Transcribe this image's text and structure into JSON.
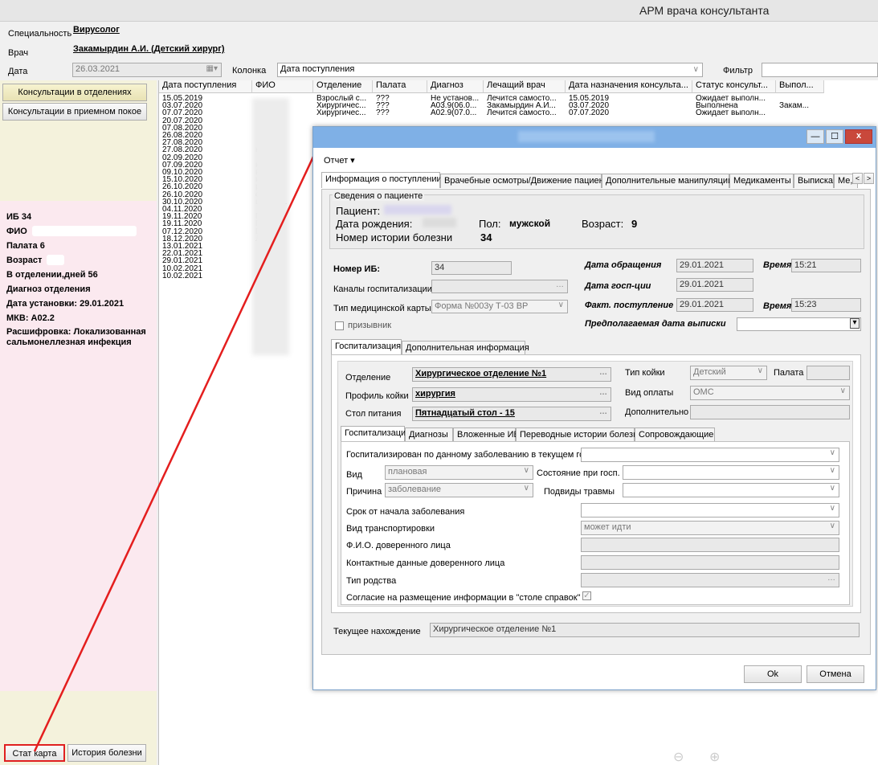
{
  "app": {
    "title": "АРМ врача консультанта"
  },
  "header": {
    "specialty_label": "Специальность",
    "specialty_value": "Вирусолог",
    "doctor_label": "Врач",
    "doctor_value": "Закамырдин А.И. (Детский хирург)",
    "date_label": "Дата",
    "date_value": "26.03.2021",
    "column_label": "Колонка",
    "column_value": "Дата поступления",
    "filter_label": "Фильтр",
    "filter_value": ""
  },
  "left": {
    "btn_department": "Консультации в отделениях",
    "btn_reception": "Консультации в приемном покое",
    "info": {
      "ib": "ИБ 34",
      "fio": "ФИО",
      "ward": "Палата 6",
      "age": "Возраст",
      "days": "В отделении,дней 56",
      "diag_dept": "Диагноз отделения",
      "date_set": "Дата установки: 29.01.2021",
      "mkb": "МКВ: A02.2",
      "decode": "Расшифровка: Локализованная сальмонеллезная инфекция"
    },
    "btn_stat": "Стат карта",
    "btn_history": "История болезни"
  },
  "grid": {
    "columns": [
      "Дата поступления",
      "ФИО",
      "Отделение",
      "Палата",
      "Диагноз",
      "Лечащий врач",
      "Дата назначения консульта...",
      "Статус консульт...",
      "Выпол..."
    ],
    "rows": [
      [
        "15.05.2019",
        "",
        "Взрослый с...",
        "???",
        "Не установ...",
        "Лечится самосто...",
        "15.05.2019",
        "Ожидает выполн...",
        ""
      ],
      [
        "03.07.2020",
        "",
        "Хирургичес...",
        "???",
        "A03.9(06.0...",
        "Закамырдин А.И...",
        "03.07.2020",
        "Выполнена",
        "Закам..."
      ],
      [
        "07.07.2020",
        "",
        "Хирургичес...",
        "???",
        "A02.9(07.0...",
        "Лечится самосто...",
        "07.07.2020",
        "Ожидает выполн...",
        ""
      ],
      [
        "20.07.2020",
        "",
        "",
        "",
        "",
        "",
        "",
        "",
        ""
      ],
      [
        "07.08.2020",
        "",
        "",
        "",
        "",
        "",
        "",
        "",
        ""
      ],
      [
        "26.08.2020",
        "",
        "",
        "",
        "",
        "",
        "",
        "",
        ""
      ],
      [
        "27.08.2020",
        "",
        "",
        "",
        "",
        "",
        "",
        "",
        ""
      ],
      [
        "27.08.2020",
        "ный ...",
        "",
        "",
        "",
        "",
        "",
        "",
        ""
      ],
      [
        "02.09.2020",
        "",
        "",
        "",
        "",
        "",
        "",
        "",
        ""
      ],
      [
        "07.09.2020",
        "кова ...",
        "",
        "",
        "",
        "",
        "",
        "",
        ""
      ],
      [
        "09.10.2020",
        "вый ...",
        "",
        "",
        "",
        "",
        "",
        "",
        ""
      ],
      [
        "15.10.2020",
        "ина...",
        "",
        "",
        "",
        "",
        "",
        "",
        ""
      ],
      [
        "26.10.2020",
        "ром...",
        "",
        "",
        "",
        "",
        "",
        "",
        ""
      ],
      [
        "26.10.2020",
        "ов К...",
        "",
        "",
        "",
        "",
        "",
        "",
        ""
      ],
      [
        "30.10.2020",
        "ьцов А...",
        "",
        "",
        "",
        "",
        "",
        "",
        ""
      ],
      [
        "04.11.2020",
        "",
        "",
        "",
        "",
        "",
        "",
        "",
        ""
      ],
      [
        "19.11.2020",
        "Петр",
        "",
        "",
        "",
        "",
        "",
        "",
        ""
      ],
      [
        "19.11.2020",
        "Пет",
        "",
        "",
        "",
        "",
        "",
        "",
        ""
      ],
      [
        "07.12.2020",
        "Вол",
        "",
        "",
        "",
        "",
        "",
        "",
        ""
      ],
      [
        "18.12.2020",
        "Лив",
        "",
        "",
        "",
        "",
        "",
        "",
        ""
      ],
      [
        "13.01.2021",
        "",
        "",
        "",
        "",
        "",
        "",
        "",
        ""
      ],
      [
        "22.01.2021",
        "",
        "",
        "",
        "",
        "",
        "",
        "",
        ""
      ],
      [
        "29.01.2021",
        "",
        "",
        "",
        "",
        "",
        "",
        "",
        ""
      ],
      [
        "10.02.2021",
        "",
        "",
        "",
        "",
        "",
        "",
        "",
        ""
      ],
      [
        "10.02.2021",
        "",
        "",
        "",
        "",
        "",
        "",
        "",
        ""
      ]
    ]
  },
  "dialog": {
    "minimize": "—",
    "maximize": "☐",
    "close": "x",
    "menu_report": "Отчет ▾",
    "tabs": [
      "Информация о поступлении",
      "Врачебные осмотры/Движение пациента",
      "Дополнительные манипуляции",
      "Медикаменты",
      "Выписка",
      "Ме,"
    ],
    "patient_group": "Сведения о пациенте",
    "patient_label": "Пациент:",
    "birth_label": "Дата рождения:",
    "sex_label": "Пол:",
    "sex_value": "мужской",
    "age_label": "Возраст:",
    "age_value": "9",
    "history_label": "Номер истории болезни",
    "history_value": "34",
    "ib_label": "Номер ИБ:",
    "ib_value": "34",
    "channels_label": "Каналы госпитализации",
    "card_type_label": "Тип медицинской карты",
    "card_type_value": "Форма №003у Т-03 ВР",
    "conscript_label": "призывник",
    "appeal_date_label": "Дата обращения",
    "appeal_date_value": "29.01.2021",
    "time_label": "Время",
    "appeal_time_value": "15:21",
    "hosp_date_label": "Дата госп-ции",
    "hosp_date_value": "29.01.2021",
    "fact_label": "Факт. поступление",
    "fact_date_value": "29.01.2021",
    "fact_time_value": "15:23",
    "discharge_label": "Предполагаемая дата выписки",
    "subtabs": [
      "Госпитализация",
      "Дополнительная информация"
    ],
    "dept_label": "Отделение",
    "dept_value": "Хирургическое отделение №1",
    "profile_label": "Профиль койки",
    "profile_value": "хирургия",
    "food_label": "Стол питания",
    "food_value": "Пятнадцатый стол - 15",
    "bed_type_label": "Тип койки",
    "bed_type_value": "Детский",
    "ward_label": "Палата",
    "pay_label": "Вид оплаты",
    "pay_value": "ОМС",
    "extra_label": "Дополнительно",
    "inner_tabs": [
      "Госпитализация",
      "Диагнозы",
      "Вложенные ИБ",
      "Переводные истории болезни",
      "Сопровождающие"
    ],
    "hosp_same_label": "Госпитализирован по данному заболеванию в текущем году",
    "kind_label": "Вид",
    "kind_value": "плановая",
    "state_label": "Состояние при госп.",
    "reason_label": "Причина",
    "reason_value": "заболевание",
    "trauma_label": "Подвиды травмы",
    "term_label": "Срок от начала заболевания",
    "transport_label": "Вид транспортировки",
    "transport_value": "может идти",
    "trustee_label": "Ф.И.О. доверенного лица",
    "contacts_label": "Контактные данные доверенного лица",
    "kin_label": "Тип родства",
    "consent_label": "Согласие на размещение информации в \"столе справок\"",
    "current_label": "Текущее нахождение",
    "current_value": "Хирургическое отделение №1",
    "ok": "Ok",
    "cancel": "Отмена"
  }
}
